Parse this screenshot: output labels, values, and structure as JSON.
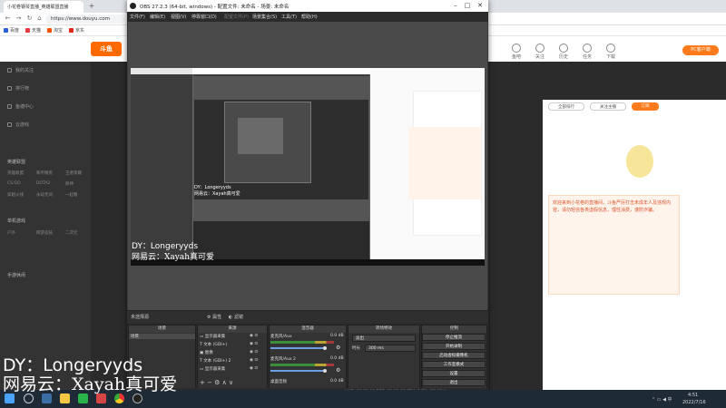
{
  "browser": {
    "tab_title": "小花卷钢琴直播_英雄联盟直播",
    "url": "https://www.douyu.com",
    "bookmarks": [
      "百度",
      "天猫",
      "淘宝",
      "京东"
    ],
    "header_icons": [
      "鱼吧",
      "关注",
      "历史",
      "任务",
      "下载"
    ],
    "pc_button": "PC客户端",
    "site_logo": "斗鱼",
    "nav_items": [
      "我的关注",
      "排行榜",
      "鱼塘中心",
      "云游戏"
    ],
    "nav_section_1": "英雄联盟",
    "nav_section_2": "单机游戏",
    "nav_section_3": "手游休闲",
    "grid_games": [
      "英雄联盟",
      "和平精英",
      "王者荣耀",
      "CS:GO",
      "DOTA2",
      "原神",
      "穿越火线",
      "永劫无间",
      "一起看",
      "户外",
      "网游竞技",
      "二次元"
    ],
    "right_buttons": [
      "全部排行",
      "关注主播",
      "订阅"
    ],
    "notice": "欢迎来到小花卷的直播间，斗鱼严厉打击未成年人及违规内容，请勿轻信各类虚假信息，理性消费，谨防诈骗。"
  },
  "obs": {
    "title": "OBS 27.2.3 (64-bit, windows) - 配置文件: 未命名 - 场景: 未命名",
    "menu": [
      "文件(F)",
      "编辑(E)",
      "视图(V)",
      "停靠窗口(D)",
      "配置文件(P)",
      "场景集合(S)",
      "工具(T)",
      "帮助(H)"
    ],
    "dock_bar_left": "未选择源",
    "dock_bar_props": "属性",
    "dock_bar_filters": "滤镜",
    "docks": {
      "scenes_title": "场景",
      "sources_title": "来源",
      "mixer_title": "混音器",
      "transitions_title": "转场特效",
      "controls_title": "控制"
    },
    "scenes": [
      "场景"
    ],
    "sources": [
      "显示器采集",
      "文本 (GDI+)",
      "图像",
      "文本 (GDI+) 2",
      "显示器采集"
    ],
    "mixer": [
      {
        "name": "麦克风/Aux",
        "db": "0.0 dB"
      },
      {
        "name": "麦克风/Aux 2",
        "db": "0.0 dB"
      },
      {
        "name": "桌面音频",
        "db": "0.0 dB"
      }
    ],
    "transition": {
      "type": "淡出",
      "duration_label": "时长",
      "duration": "300 ms"
    },
    "controls": [
      "停止推流",
      "开始录制",
      "启动虚拟摄像机",
      "工作室模式",
      "设置",
      "退出"
    ],
    "status": "LIVE: 00:00:00  REC: 00:00:00  CPU: 3.2%, 30.00 fps"
  },
  "preview_caption": {
    "line1": "DY：Longeryyds",
    "line2": "网易云：Xayah真可爱"
  },
  "overlay_caption": {
    "line1": "DY：Longeryyds",
    "line2": "网易云：Xayah真可爱"
  },
  "taskbar": {
    "time": "4:51",
    "date": "2022/7/16",
    "lang": "中"
  }
}
